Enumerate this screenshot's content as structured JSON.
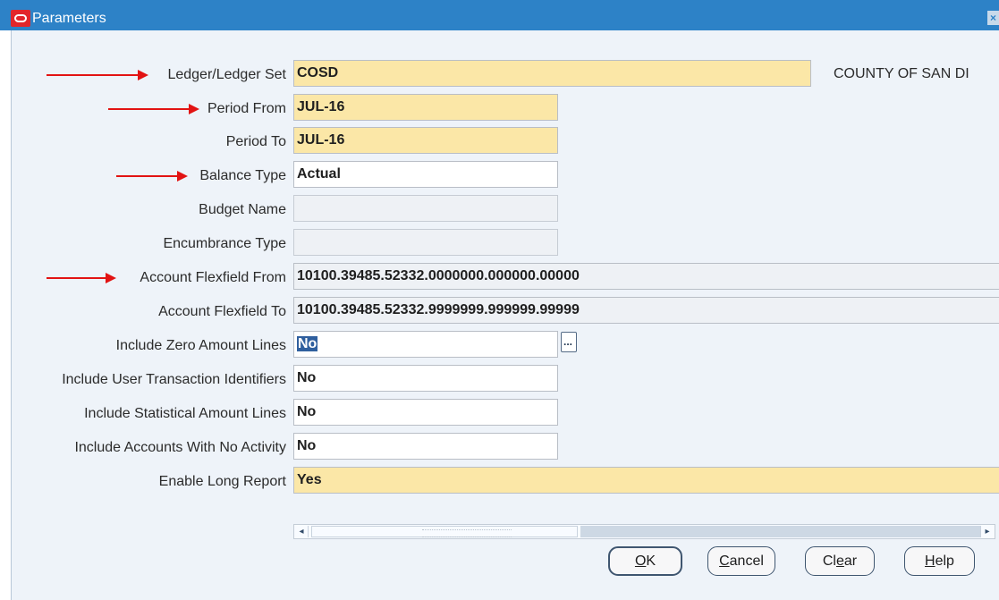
{
  "window": {
    "title": "Parameters",
    "close_symbol": "×"
  },
  "form": {
    "rows": [
      {
        "label": "Ledger/Ledger Set",
        "value": "COSD",
        "style": "yellow",
        "arrow": true
      },
      {
        "label": "Period From",
        "value": "JUL-16",
        "style": "yellow",
        "arrow": true
      },
      {
        "label": "Period To",
        "value": "JUL-16",
        "style": "yellow",
        "arrow": false
      },
      {
        "label": "Balance Type",
        "value": "Actual",
        "style": "white",
        "arrow": true
      },
      {
        "label": "Budget Name",
        "value": "",
        "style": "disabled",
        "arrow": false
      },
      {
        "label": "Encumbrance Type",
        "value": "",
        "style": "disabled",
        "arrow": false
      },
      {
        "label": "Account Flexfield From",
        "value": "10100.39485.52332.0000000.000000.00000",
        "style": "gray",
        "arrow": true
      },
      {
        "label": "Account Flexfield To",
        "value": "10100.39485.52332.9999999.999999.99999",
        "style": "gray",
        "arrow": false
      },
      {
        "label": "Include Zero Amount Lines",
        "value": "No",
        "style": "white",
        "arrow": false
      },
      {
        "label": "Include User Transaction Identifiers",
        "value": "No",
        "style": "white",
        "arrow": false
      },
      {
        "label": "Include Statistical Amount Lines",
        "value": "No",
        "style": "white",
        "arrow": false
      },
      {
        "label": "Include Accounts With No Activity",
        "value": "No",
        "style": "white",
        "arrow": false
      },
      {
        "label": "Enable Long Report",
        "value": "Yes",
        "style": "yellow",
        "arrow": false
      }
    ],
    "ledger_description": "COUNTY OF SAN DI",
    "lov_button_symbol": "..."
  },
  "scrollbar": {
    "left_arrow": "◂",
    "right_arrow": "▸",
    "position": 0.0
  },
  "buttons": {
    "ok": {
      "mnemonic": "O",
      "rest": "K"
    },
    "cancel": {
      "mnemonic": "C",
      "rest": "ancel"
    },
    "clear": {
      "prefix": "Cl",
      "mnemonic": "e",
      "rest": "ar"
    },
    "help": {
      "mnemonic": "H",
      "rest": "elp"
    }
  },
  "colors": {
    "title_bar": "#2d82c7",
    "required_field": "#fbe7a7",
    "arrow": "#e21313"
  }
}
